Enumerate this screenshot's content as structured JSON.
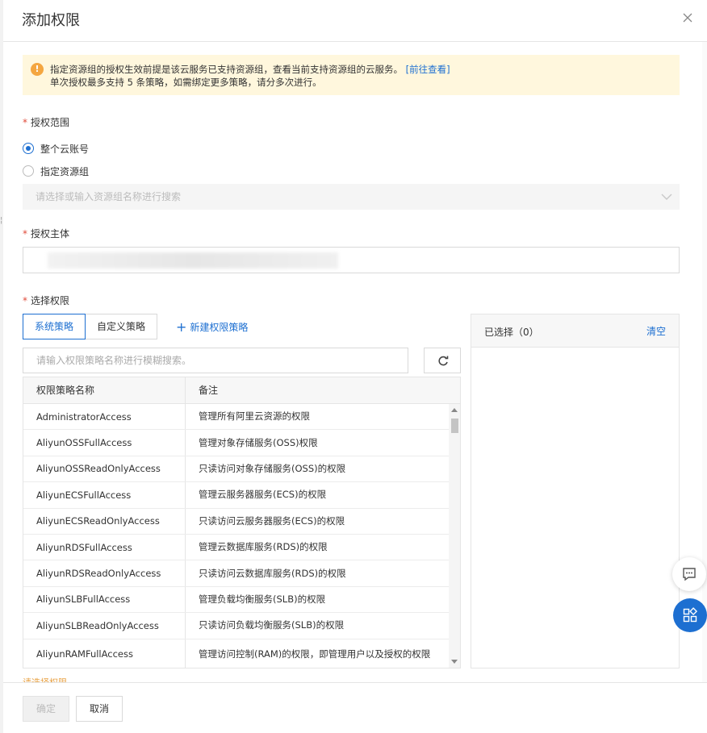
{
  "dialog": {
    "title": "添加权限"
  },
  "notice": {
    "line1": "指定资源组的授权生效前提是该云服务已支持资源组，查看当前支持资源组的云服务。",
    "link": "[前往查看]",
    "line2": "单次授权最多支持 5 条策略，如需绑定更多策略，请分多次进行。"
  },
  "scope": {
    "label": "授权范围",
    "required_mark": "*",
    "options": [
      {
        "label": "整个云账号",
        "checked": true
      },
      {
        "label": "指定资源组",
        "checked": false
      }
    ],
    "resource_group_placeholder": "请选择或输入资源组名称进行搜索"
  },
  "principal": {
    "label": "授权主体",
    "required_mark": "*"
  },
  "permissions": {
    "label": "选择权限",
    "required_mark": "*",
    "tabs": [
      {
        "label": "系统策略",
        "active": true
      },
      {
        "label": "自定义策略",
        "active": false
      }
    ],
    "new_policy": "新建权限策略",
    "search_placeholder": "请输入权限策略名称进行模糊搜索。",
    "columns": [
      "权限策略名称",
      "备注"
    ],
    "rows": [
      [
        "AdministratorAccess",
        "管理所有阿里云资源的权限"
      ],
      [
        "AliyunOSSFullAccess",
        "管理对象存储服务(OSS)权限"
      ],
      [
        "AliyunOSSReadOnlyAccess",
        "只读访问对象存储服务(OSS)的权限"
      ],
      [
        "AliyunECSFullAccess",
        "管理云服务器服务(ECS)的权限"
      ],
      [
        "AliyunECSReadOnlyAccess",
        "只读访问云服务器服务(ECS)的权限"
      ],
      [
        "AliyunRDSFullAccess",
        "管理云数据库服务(RDS)的权限"
      ],
      [
        "AliyunRDSReadOnlyAccess",
        "只读访问云数据库服务(RDS)的权限"
      ],
      [
        "AliyunSLBFullAccess",
        "管理负载均衡服务(SLB)的权限"
      ],
      [
        "AliyunSLBReadOnlyAccess",
        "只读访问负载均衡服务(SLB)的权限"
      ],
      [
        "AliyunRAMFullAccess",
        "管理访问控制(RAM)的权限，即管理用户以及授权的权限"
      ]
    ],
    "hint": "请选择权限"
  },
  "selected": {
    "title": "已选择（0）",
    "clear": "清空"
  },
  "footer": {
    "ok": "确定",
    "cancel": "取消"
  },
  "colors": {
    "accent": "#1d6fd1",
    "warning_bg": "#fff7dd",
    "warning_icon": "#f4a640",
    "required": "#e04b3a"
  }
}
